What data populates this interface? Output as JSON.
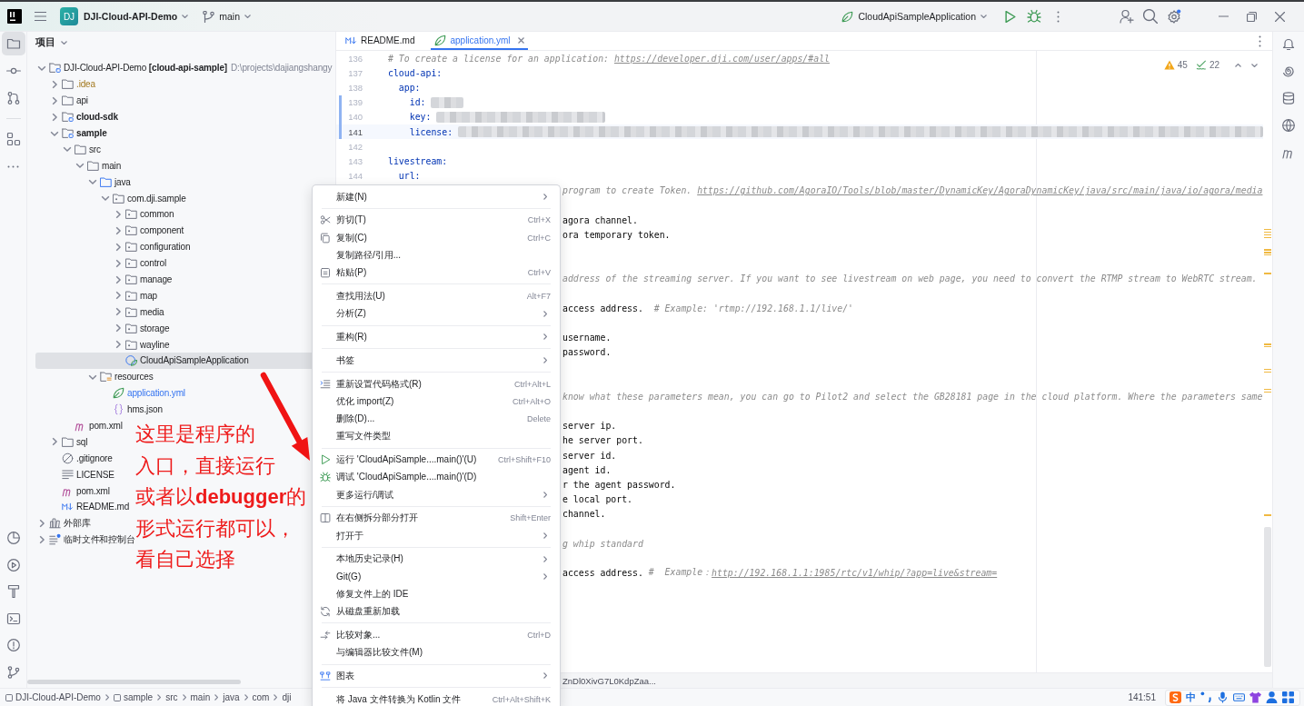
{
  "title_bar": {
    "project_badge": "DJ",
    "project": "DJI-Cloud-API-Demo",
    "branch": "main",
    "run_config": "CloudApiSampleApplication"
  },
  "left_toolbar": {
    "top": [
      {
        "selected": true
      },
      {
        "selected": false
      },
      {
        "selected": false
      },
      {
        "selected": false
      },
      {
        "selected": false
      }
    ],
    "bottom": [
      {
        "selected": false
      },
      {
        "selected": false
      },
      {
        "selected": false
      },
      {
        "selected": false
      },
      {
        "selected": false
      },
      {
        "selected": false
      }
    ]
  },
  "project_panel": {
    "title": "项目",
    "tree": [
      {
        "label": "DJI-Cloud-API-Demo **[cloud-api-sample]**",
        "path": "D:\\projects\\dajiangshangy",
        "kind": "project",
        "expanded": true,
        "selected": false,
        "children": [
          {
            "label": ".idea",
            "kind": "folder",
            "ignored": true,
            "expanded": false,
            "selected": false
          },
          {
            "label": "api",
            "kind": "folder",
            "expanded": false,
            "selected": false
          },
          {
            "label": "cloud-sdk",
            "kind": "module",
            "expanded": false,
            "selected": false
          },
          {
            "label": "sample",
            "kind": "module",
            "expanded": true,
            "selected": false,
            "children": [
              {
                "label": "src",
                "kind": "folder",
                "expanded": true,
                "selected": false,
                "children": [
                  {
                    "label": "main",
                    "kind": "folder",
                    "expanded": true,
                    "selected": false,
                    "children": [
                      {
                        "label": "java",
                        "kind": "source-folder",
                        "expanded": true,
                        "selected": false,
                        "children": [
                          {
                            "label": "com.dji.sample",
                            "kind": "package",
                            "expanded": true,
                            "selected": false,
                            "children": [
                              {
                                "label": "common",
                                "kind": "package",
                                "expanded": false,
                                "selected": false
                              },
                              {
                                "label": "component",
                                "kind": "package",
                                "expanded": false,
                                "selected": false
                              },
                              {
                                "label": "configuration",
                                "kind": "package",
                                "expanded": false,
                                "selected": false
                              },
                              {
                                "label": "control",
                                "kind": "package",
                                "expanded": false,
                                "selected": false
                              },
                              {
                                "label": "manage",
                                "kind": "package",
                                "expanded": false,
                                "selected": false
                              },
                              {
                                "label": "map",
                                "kind": "package",
                                "expanded": false,
                                "selected": false
                              },
                              {
                                "label": "media",
                                "kind": "package",
                                "expanded": false,
                                "selected": false
                              },
                              {
                                "label": "storage",
                                "kind": "package",
                                "expanded": false,
                                "selected": false
                              },
                              {
                                "label": "wayline",
                                "kind": "package",
                                "expanded": false,
                                "selected": false
                              },
                              {
                                "label": "CloudApiSampleApplication",
                                "kind": "spring-class",
                                "selected": true
                              }
                            ]
                          }
                        ]
                      },
                      {
                        "label": "resources",
                        "kind": "resources-folder",
                        "expanded": true,
                        "selected": false,
                        "children": [
                          {
                            "label": "application.yml",
                            "kind": "yaml",
                            "modified": true,
                            "selected": false
                          },
                          {
                            "label": "hms.json",
                            "kind": "json",
                            "selected": false
                          }
                        ]
                      }
                    ]
                  }
                ]
              },
              {
                "label": "pom.xml",
                "kind": "maven",
                "selected": false
              }
            ]
          },
          {
            "label": "sql",
            "kind": "folder",
            "expanded": false,
            "selected": false
          },
          {
            "label": ".gitignore",
            "kind": "ignore-file",
            "selected": false
          },
          {
            "label": "LICENSE",
            "kind": "text-file",
            "selected": false
          },
          {
            "label": "pom.xml",
            "kind": "maven",
            "selected": false
          },
          {
            "label": "README.md",
            "kind": "markdown",
            "selected": false
          }
        ]
      },
      {
        "label": "外部库",
        "kind": "library",
        "expanded": false,
        "selected": false
      },
      {
        "label": "临时文件和控制台",
        "kind": "scratch",
        "expanded": false,
        "selected": false
      }
    ]
  },
  "editor": {
    "tabs": [
      {
        "label": "README.md",
        "kind": "markdown",
        "selected": false
      },
      {
        "label": "application.yml",
        "kind": "yaml",
        "modified": true,
        "selected": true
      }
    ],
    "warnings": "45",
    "weak_warnings": "22",
    "lines": [
      {
        "number": "136",
        "current": false,
        "changed": false,
        "segments": [
          {
            "text": "# To create a license for an application: ",
            "kind": "comment"
          },
          {
            "text": "https://developer.dji.com/user/apps/#all",
            "kind": "link"
          }
        ]
      },
      {
        "number": "137",
        "current": false,
        "changed": false,
        "segments": [
          {
            "text": "cloud-api:",
            "kind": "key"
          }
        ],
        "children": [
          {
            "number": "138",
            "current": false,
            "changed": false,
            "segments": [
              {
                "text": "app:",
                "kind": "key"
              }
            ],
            "children": [
              {
                "number": "139",
                "current": false,
                "changed": true,
                "redacted": true,
                "segments": [
                  {
                    "text": "id:",
                    "kind": "key"
                  }
                ]
              },
              {
                "number": "140",
                "current": false,
                "changed": true,
                "redacted": true,
                "segments": [
                  {
                    "text": "key:",
                    "kind": "key"
                  }
                ]
              },
              {
                "number": "141",
                "current": true,
                "changed": true,
                "redacted": true,
                "segments": [
                  {
                    "text": "license:",
                    "kind": "key"
                  }
                ]
              }
            ]
          }
        ]
      },
      {
        "number": "142",
        "current": false,
        "changed": false
      },
      {
        "number": "143",
        "current": false,
        "changed": false,
        "segments": [
          {
            "text": "livestream:",
            "kind": "key"
          }
        ],
        "children": [
          {
            "number": "144",
            "current": false,
            "changed": false,
            "segments": [
              {
                "text": "url:",
                "kind": "key"
              }
            ]
          }
        ]
      }
    ],
    "lines_behind_menu": [
      {
        "kind": "text",
        "segments": [
          {
            "text": "program to create Token. ",
            "kind": "comment"
          },
          {
            "text": "https://github.com/AgoraIO/Tools/blob/master/DynamicKey/AgoraDynamicKey/java/src/main/java/io/agora/media",
            "kind": "link"
          }
        ]
      },
      {
        "kind": "blank"
      },
      {
        "kind": "text",
        "segments": [
          {
            "text": "agora channel.",
            "kind": "plain"
          }
        ]
      },
      {
        "kind": "text",
        "segments": [
          {
            "text": "ora temporary token.",
            "kind": "plain"
          }
        ]
      },
      {
        "kind": "blank"
      },
      {
        "kind": "blank"
      },
      {
        "kind": "text",
        "segments": [
          {
            "text": "address of the streaming server. If you want to see livestream on web page, you need to convert the RTMP stream to WebRTC stream.",
            "kind": "comment"
          }
        ]
      },
      {
        "kind": "blank"
      },
      {
        "kind": "text",
        "segments": [
          {
            "text": "access address.  ",
            "kind": "plain"
          },
          {
            "text": "# Example: 'rtmp://192.168.1.1/live/'",
            "kind": "comment"
          }
        ]
      },
      {
        "kind": "blank"
      },
      {
        "kind": "text",
        "segments": [
          {
            "text": "username.",
            "kind": "plain"
          }
        ]
      },
      {
        "kind": "text",
        "segments": [
          {
            "text": "password.",
            "kind": "plain"
          }
        ]
      },
      {
        "kind": "blank"
      },
      {
        "kind": "blank"
      },
      {
        "kind": "text",
        "segments": [
          {
            "text": "know what these parameters mean, you can go to Pilot2 and select the GB28181 page in the cloud platform. Where the parameters same",
            "kind": "comment"
          }
        ]
      },
      {
        "kind": "blank"
      },
      {
        "kind": "text",
        "segments": [
          {
            "text": "server ip.",
            "kind": "plain"
          }
        ]
      },
      {
        "kind": "text",
        "segments": [
          {
            "text": "he server port.",
            "kind": "plain"
          }
        ]
      },
      {
        "kind": "text",
        "segments": [
          {
            "text": "server id.",
            "kind": "plain"
          }
        ]
      },
      {
        "kind": "text",
        "segments": [
          {
            "text": "agent id.",
            "kind": "plain"
          }
        ]
      },
      {
        "kind": "text",
        "segments": [
          {
            "text": "r the agent password.",
            "kind": "plain"
          }
        ]
      },
      {
        "kind": "text",
        "segments": [
          {
            "text": "e local port.",
            "kind": "plain"
          }
        ]
      },
      {
        "kind": "text",
        "segments": [
          {
            "text": "channel.",
            "kind": "plain"
          }
        ]
      },
      {
        "kind": "blank"
      },
      {
        "kind": "text",
        "segments": [
          {
            "text": "g whip standard",
            "kind": "comment"
          }
        ]
      },
      {
        "kind": "blank"
      },
      {
        "kind": "text",
        "segments": [
          {
            "text": "access address. ",
            "kind": "plain"
          },
          {
            "text": "#  Example：",
            "kind": "comment"
          },
          {
            "text": "http://192.168.1.1:1985/rtc/v1/whip/?app=live&stream=",
            "kind": "link"
          }
        ]
      }
    ],
    "breadcrumb": "ZnDl0XivG7L0KdpZaa..."
  },
  "context_menu": {
    "groups": [
      [
        {
          "label": "新建(N)",
          "kind": "plain",
          "submenu": true
        }
      ],
      [
        {
          "label": "剪切(T)",
          "shortcut": "Ctrl+X",
          "kind": "cut"
        },
        {
          "label": "复制(C)",
          "shortcut": "Ctrl+C",
          "kind": "copy"
        },
        {
          "label": "复制路径/引用...",
          "kind": "plain"
        },
        {
          "label": "粘贴(P)",
          "shortcut": "Ctrl+V",
          "kind": "paste"
        }
      ],
      [
        {
          "label": "查找用法(U)",
          "shortcut": "Alt+F7",
          "kind": "plain"
        },
        {
          "label": "分析(Z)",
          "kind": "plain",
          "submenu": true
        }
      ],
      [
        {
          "label": "重构(R)",
          "kind": "plain",
          "submenu": true
        }
      ],
      [
        {
          "label": "书签",
          "kind": "plain",
          "submenu": true
        }
      ],
      [
        {
          "label": "重新设置代码格式(R)",
          "shortcut": "Ctrl+Alt+L",
          "kind": "reformat"
        },
        {
          "label": "优化 import(Z)",
          "shortcut": "Ctrl+Alt+O",
          "kind": "plain"
        },
        {
          "label": "删除(D)...",
          "shortcut": "Delete",
          "kind": "plain"
        },
        {
          "label": "重写文件类型",
          "kind": "plain"
        }
      ],
      [
        {
          "label": "运行 'CloudApiSample....main()'(U)",
          "shortcut": "Ctrl+Shift+F10",
          "kind": "run"
        },
        {
          "label": "调试 'CloudApiSample....main()'(D)",
          "kind": "debug"
        },
        {
          "label": "更多运行/调试",
          "kind": "plain",
          "submenu": true
        }
      ],
      [
        {
          "label": "在右侧拆分部分打开",
          "shortcut": "Shift+Enter",
          "kind": "split"
        },
        {
          "label": "打开于",
          "kind": "plain",
          "submenu": true
        }
      ],
      [
        {
          "label": "本地历史记录(H)",
          "kind": "plain",
          "submenu": true
        },
        {
          "label": "Git(G)",
          "kind": "plain",
          "submenu": true
        },
        {
          "label": "修复文件上的 IDE",
          "kind": "plain"
        },
        {
          "label": "从磁盘重新加载",
          "kind": "reload"
        }
      ],
      [
        {
          "label": "比较对象...",
          "shortcut": "Ctrl+D",
          "kind": "compare"
        },
        {
          "label": "与编辑器比较文件(M)",
          "kind": "plain"
        }
      ],
      [
        {
          "label": "图表",
          "kind": "diagram",
          "submenu": true
        }
      ],
      [
        {
          "label": "将 Java 文件转换为 Kotlin 文件",
          "shortcut": "Ctrl+Alt+Shift+K",
          "kind": "plain"
        }
      ]
    ]
  },
  "annotation": {
    "lines": [
      "这里是程序的",
      "入口，直接运行",
      "或者以**debugger**的",
      "形式运行都可以，",
      "看自己选择"
    ]
  },
  "status_bar": {
    "breadcrumbs": [
      {
        "label": "DJI-Cloud-API-Demo",
        "kind": "module"
      },
      {
        "label": "sample",
        "kind": "module"
      },
      {
        "label": "src",
        "kind": "folder"
      },
      {
        "label": "main",
        "kind": "folder"
      },
      {
        "label": "java",
        "kind": "folder"
      },
      {
        "label": "com",
        "kind": "folder"
      },
      {
        "label": "dji",
        "kind": "folder"
      }
    ],
    "caret": "141:51",
    "ime_mode": "中"
  }
}
